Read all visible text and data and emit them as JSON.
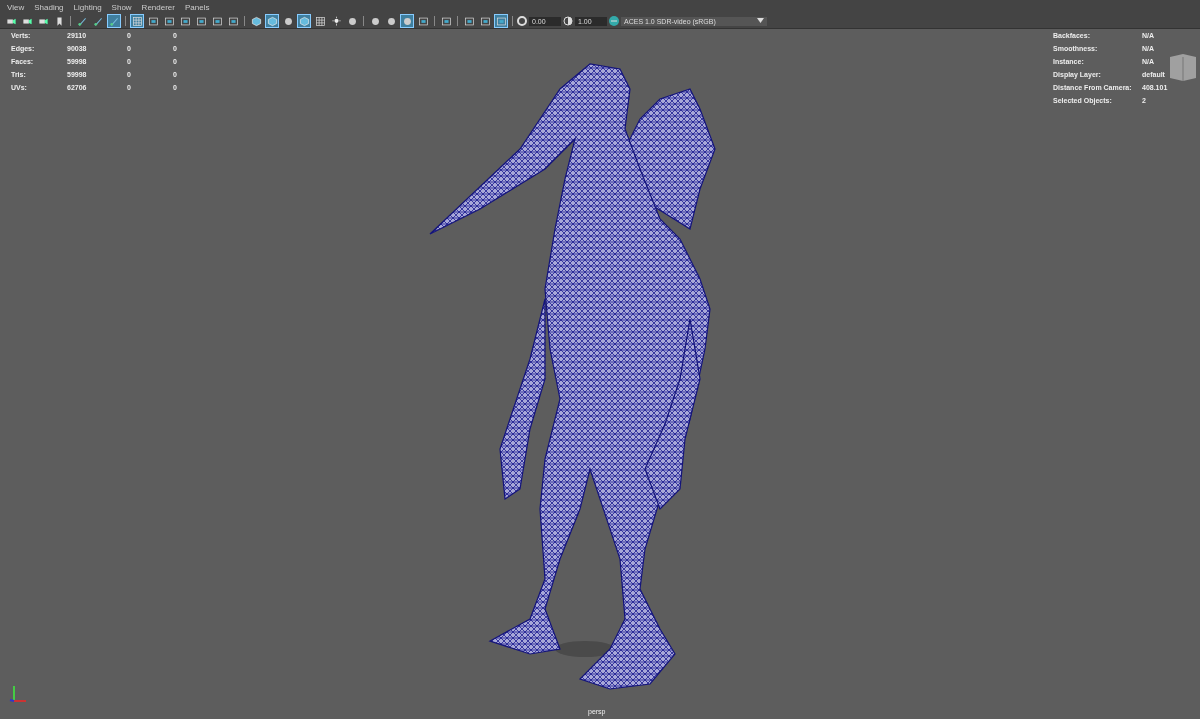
{
  "menu": [
    "View",
    "Shading",
    "Lighting",
    "Show",
    "Renderer",
    "Panels"
  ],
  "toolbar": [
    {
      "kind": "camera",
      "selected": false
    },
    {
      "kind": "camera",
      "selected": false
    },
    {
      "kind": "camera",
      "selected": false
    },
    {
      "kind": "bookmark",
      "selected": false
    },
    {
      "kind": "sep"
    },
    {
      "kind": "pen",
      "selected": false
    },
    {
      "kind": "pen",
      "selected": false
    },
    {
      "kind": "pen",
      "selected": true
    },
    {
      "kind": "sep"
    },
    {
      "kind": "grid",
      "selected": true
    },
    {
      "kind": "gate",
      "selected": false
    },
    {
      "kind": "gate",
      "selected": false
    },
    {
      "kind": "gate",
      "selected": false
    },
    {
      "kind": "gate",
      "selected": false
    },
    {
      "kind": "gate",
      "selected": false
    },
    {
      "kind": "gate",
      "selected": false
    },
    {
      "kind": "sep"
    },
    {
      "kind": "cube",
      "selected": false
    },
    {
      "kind": "cube",
      "selected": true
    },
    {
      "kind": "sphere",
      "selected": false
    },
    {
      "kind": "cube",
      "selected": true
    },
    {
      "kind": "grid",
      "selected": false
    },
    {
      "kind": "light",
      "selected": false
    },
    {
      "kind": "sphere",
      "selected": false
    },
    {
      "kind": "sep"
    },
    {
      "kind": "sphere",
      "selected": false
    },
    {
      "kind": "sphere",
      "selected": false
    },
    {
      "kind": "sphere",
      "selected": true
    },
    {
      "kind": "gate",
      "selected": false
    },
    {
      "kind": "sep"
    },
    {
      "kind": "gate",
      "selected": false
    },
    {
      "kind": "sep"
    },
    {
      "kind": "gate",
      "selected": false
    },
    {
      "kind": "gate",
      "selected": false
    },
    {
      "kind": "gate",
      "selected": true
    },
    {
      "kind": "sep"
    }
  ],
  "exposure": {
    "value": "0.00"
  },
  "gamma": {
    "value": "1.00"
  },
  "color_space": {
    "value": "ACES 1.0 SDR-video (sRGB)"
  },
  "stats": [
    {
      "label": "Verts:",
      "values": [
        "29110",
        "0",
        "0"
      ]
    },
    {
      "label": "Edges:",
      "values": [
        "90038",
        "0",
        "0"
      ]
    },
    {
      "label": "Faces:",
      "values": [
        "59998",
        "0",
        "0"
      ]
    },
    {
      "label": "Tris:",
      "values": [
        "59998",
        "0",
        "0"
      ]
    },
    {
      "label": "UVs:",
      "values": [
        "62706",
        "0",
        "0"
      ]
    }
  ],
  "info": [
    {
      "label": "Backfaces:",
      "value": "N/A"
    },
    {
      "label": "Smoothness:",
      "value": "N/A"
    },
    {
      "label": "Instance:",
      "value": "N/A"
    },
    {
      "label": "Display Layer:",
      "value": "default"
    },
    {
      "label": "Distance From Camera:",
      "value": "408.101"
    },
    {
      "label": "Selected Objects:",
      "value": "2"
    }
  ],
  "camera_name": "persp"
}
